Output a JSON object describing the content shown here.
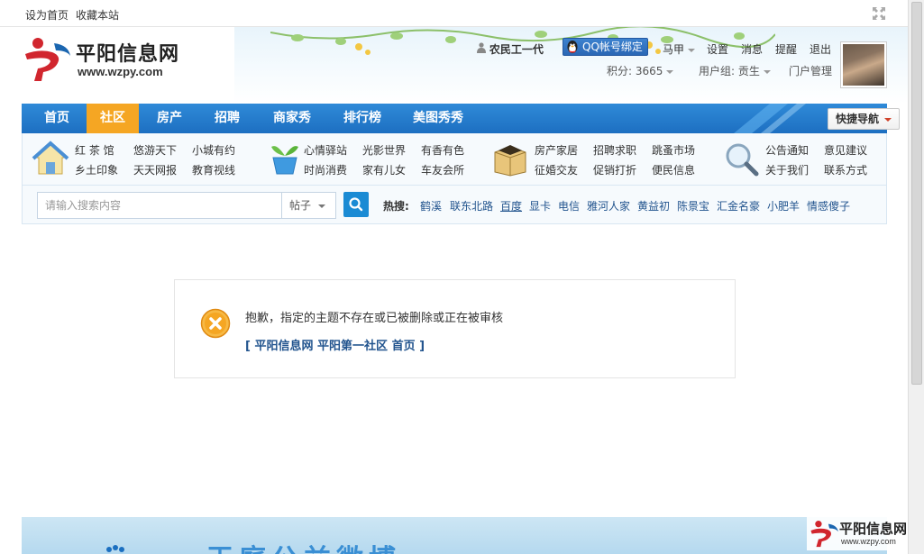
{
  "topbar": {
    "set_home": "设为首页",
    "bookmark": "收藏本站"
  },
  "logo": {
    "name": "平阳信息网",
    "url": "www.wzpy.com"
  },
  "user": {
    "username": "农民工一代",
    "qq_bind": "QQ帐号绑定",
    "account": "马甲",
    "settings": "设置",
    "messages": "消息",
    "reminders": "提醒",
    "logout": "退出",
    "points": "积分: 3665",
    "group": "用户组: 贡生",
    "portal_admin": "门户管理"
  },
  "nav": {
    "items": [
      "首页",
      "社区",
      "房产",
      "招聘",
      "商家秀",
      "排行榜",
      "美图秀秀"
    ],
    "active": "社区",
    "quick_nav": "快捷导航"
  },
  "subnav": {
    "groups": [
      {
        "icon": "house-icon",
        "links": [
          "红 茶 馆",
          "悠游天下",
          "小城有约",
          "乡土印象",
          "天天网报",
          "教育视线"
        ]
      },
      {
        "icon": "plant-pot-icon",
        "links": [
          "心情驿站",
          "光影世界",
          "有香有色",
          "时尚消费",
          "家有儿女",
          "车友会所"
        ]
      },
      {
        "icon": "box-icon",
        "links": [
          "房产家居",
          "招聘求职",
          "跳蚤市场",
          "征婚交友",
          "促销打折",
          "便民信息"
        ]
      },
      {
        "icon": "magnifier-icon",
        "links": [
          "公告通知",
          "意见建议",
          "关于我们",
          "联系方式"
        ]
      }
    ]
  },
  "search": {
    "placeholder": "请输入搜索内容",
    "type": "帖子",
    "hot_label": "热搜:",
    "hot_terms": [
      "鹤溪",
      "联东北路",
      "百度",
      "显卡",
      "电信",
      "雅河人家",
      "黄益初",
      "陈景宝",
      "汇金名豪",
      "小肥羊",
      "情感傻子"
    ]
  },
  "message": {
    "text": "抱歉，指定的主题不存在或已被删除或正在被审核",
    "link_open": "[",
    "link_site": "平阳信息网",
    "link_forum": "平阳第一社区",
    "link_home": "首页",
    "link_close": "]"
  },
  "banner": {
    "text": "王庭公益微博",
    "float_logo_name": "平阳信息网",
    "float_logo_url": "www.wzpy.com"
  },
  "colors": {
    "nav_blue": "#1d6fc1",
    "nav_active": "#f5a623",
    "link_blue": "#22548e",
    "error_orange": "#f5a623"
  }
}
